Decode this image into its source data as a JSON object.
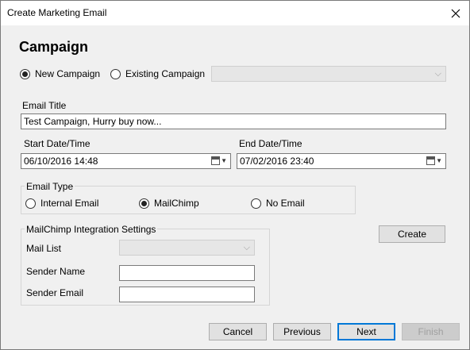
{
  "window": {
    "title": "Create Marketing Email"
  },
  "heading": "Campaign",
  "campaign": {
    "new_label": "New Campaign",
    "new_checked": true,
    "existing_label": "Existing Campaign",
    "existing_checked": false,
    "existing_value": ""
  },
  "email_title": {
    "label": "Email Title",
    "value": "Test Campaign, Hurry buy now..."
  },
  "start": {
    "label": "Start Date/Time",
    "value": "06/10/2016 14:48"
  },
  "end": {
    "label": "End Date/Time",
    "value": "07/02/2016 23:40"
  },
  "email_type": {
    "legend": "Email Type",
    "options": [
      {
        "label": "Internal Email",
        "checked": false
      },
      {
        "label": "MailChimp",
        "checked": true
      },
      {
        "label": "No Email",
        "checked": false
      }
    ]
  },
  "mailchimp": {
    "legend": "MailChimp Integration Settings",
    "mail_list_label": "Mail List",
    "mail_list_value": "",
    "sender_name_label": "Sender Name",
    "sender_name_value": "",
    "sender_email_label": "Sender Email",
    "sender_email_value": ""
  },
  "buttons": {
    "create": "Create",
    "cancel": "Cancel",
    "previous": "Previous",
    "next": "Next",
    "finish": "Finish"
  },
  "colors": {
    "default_button_border": "#0078d7",
    "disabled_text": "#a0a0a0"
  }
}
